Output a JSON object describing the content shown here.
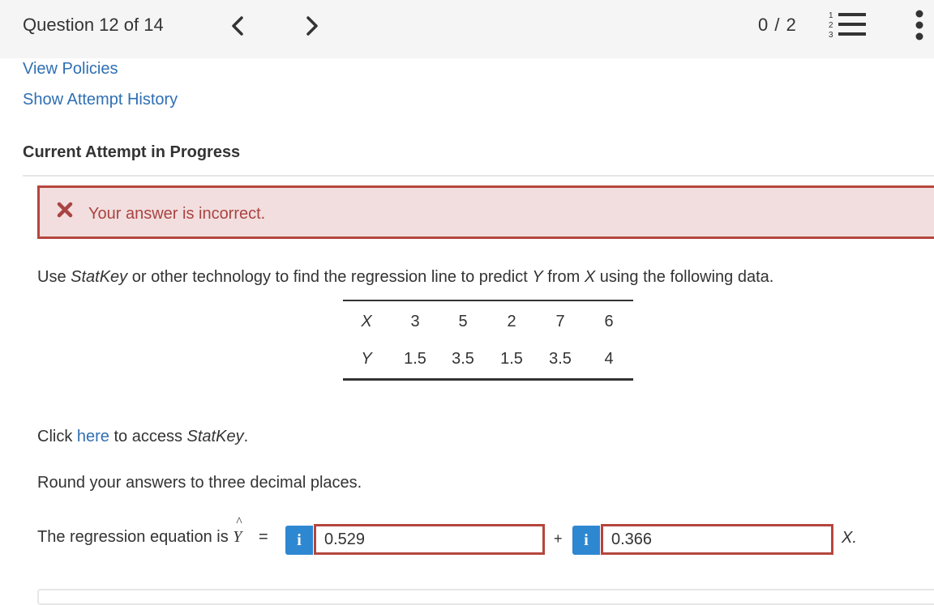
{
  "header": {
    "question_label": "Question 12 of 14",
    "score": "0 / 2",
    "icons": [
      "chevron-left-icon",
      "chevron-right-icon",
      "numbered-list-icon",
      "more-vertical-icon"
    ]
  },
  "links": {
    "view_policies": "View Policies",
    "show_attempt_history": "Show Attempt History"
  },
  "attempt_heading": "Current Attempt in Progress",
  "alert": {
    "text": "Your answer is incorrect.",
    "color": "#a94442",
    "border_color": "#b5463e",
    "bg_color": "#f2dede"
  },
  "problem": {
    "prefix": "Use ",
    "tool": "StatKey",
    "middle": " or other technology to find the regression line to predict ",
    "y_var": "Y",
    "from_text": " from ",
    "x_var": "X",
    "suffix": " using the following data."
  },
  "data_table": {
    "x_label": "X",
    "y_label": "Y",
    "x_values": [
      "3",
      "5",
      "2",
      "7",
      "6"
    ],
    "y_values": [
      "1.5",
      "3.5",
      "1.5",
      "3.5",
      "4"
    ]
  },
  "statkey_line": {
    "click": "Click ",
    "here": "here",
    "to_access": " to access ",
    "tool": "StatKey",
    "period": "."
  },
  "round_instruction": "Round your answers to three decimal places.",
  "equation": {
    "label": "The regression equation is ",
    "y_symbol": "Y",
    "hat": "^",
    "equals": "=",
    "intercept_value": "0.529",
    "plus": "+",
    "slope_value": "0.366",
    "suffix": "X.",
    "info_glyph": "i"
  }
}
